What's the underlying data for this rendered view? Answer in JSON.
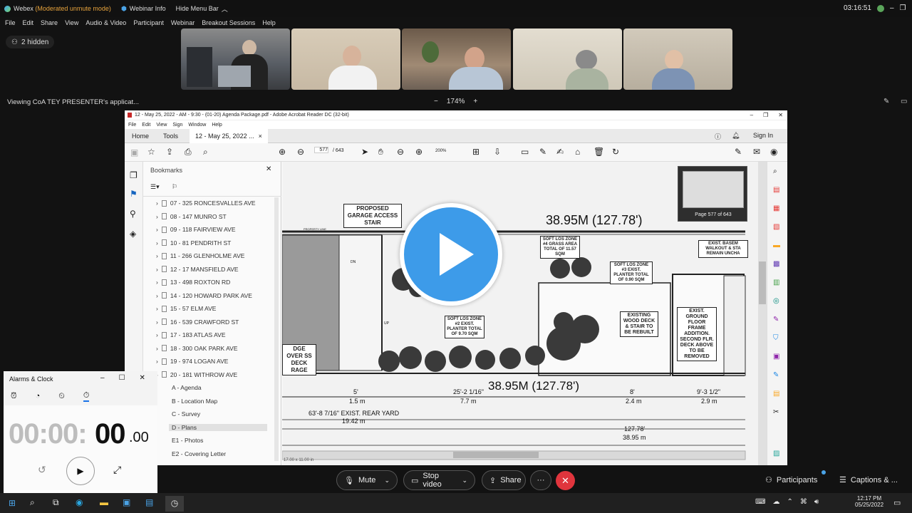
{
  "titlebar": {
    "app": "Webex",
    "mode": "(Moderated unmute mode)",
    "webinar_info": "Webinar Info",
    "hide_menu": "Hide Menu Bar",
    "clock": "03:16:51"
  },
  "menubar": [
    "File",
    "Edit",
    "Share",
    "View",
    "Audio & Video",
    "Participant",
    "Webinar",
    "Breakout Sessions",
    "Help"
  ],
  "hidden_count": "2 hidden",
  "viewing": "Viewing CoA TEY PRESENTER's applicat...",
  "zoom": {
    "minus": "−",
    "level": "174%",
    "plus": "+"
  },
  "acrobat": {
    "title": "12 - May 25, 2022 - AM - 9:30 - (01-20) Agenda Package.pdf - Adobe Acrobat Reader DC (32-bit)",
    "menu": [
      "File",
      "Edit",
      "View",
      "Sign",
      "Window",
      "Help"
    ],
    "tabs": {
      "home": "Home",
      "tools": "Tools",
      "doc": "12 - May 25, 2022 ...",
      "close": "×",
      "signin": "Sign In"
    },
    "page_current": "577",
    "page_total": "/ 643",
    "zoom": "200%",
    "bookmarks_title": "Bookmarks",
    "bookmarks": [
      "07 - 325 RONCESVALLES AVE",
      "08 - 147 MUNRO ST",
      "09 - 118 FAIRVIEW AVE",
      "10 - 81 PENDRITH ST",
      "11 - 266 GLENHOLME AVE",
      "12 - 17 MANSFIELD AVE",
      "13 - 498 ROXTON RD",
      "14 - 120 HOWARD PARK AVE",
      "15 - 57 ELM AVE",
      "16 - 539 CRAWFORD ST",
      "17 - 183 ATLAS AVE",
      "18 - 300 OAK PARK AVE",
      "19 - 974 LOGAN AVE",
      "20 - 181 WITHROW AVE"
    ],
    "sub_bookmarks": [
      "A - Agenda",
      "B - Location Map",
      "C - Survey",
      "D - Plans",
      "E1 - Photos",
      "E2 - Covering Letter"
    ],
    "page_size": "17.00 x 11.00 in",
    "thumb_label": "Page 577 of 643",
    "drawing": {
      "garage": "PROPOSED GARAGE ACCESS STAIR",
      "dim_top": "38.95M (127.78')",
      "dim_bottom": "38.95M (127.78')",
      "zone4": "SOFT LOS ZONE #4 GRASS AREA TOTAL OF 11.57 SQM",
      "zone3": "SOFT LOS ZONE #3 EXIST. PLANTER TOTAL OF 0.90 SQM",
      "zone2": "SOFT LOS ZONE #2 EXIST. PLANTER TOTAL OF 9.70 SQM",
      "wood_deck": "EXISTING WOOD DECK & STAIR TO BE REBUILT",
      "ground_floor": "EXIST. GROUND FLOOR FRAME ADDITION. SECOND FLR. DECK ABOVE TO BE REMOVED",
      "basement": "EXIST. BASEM WALKOUT & STA REMAIN UNCHA",
      "bridge": "DGE OVER SS DECK RAGE",
      "d1a": "5'",
      "d1b": "1.5 m",
      "d2a": "25'-2 1/16\"",
      "d2b": "7.7 m",
      "d3a": "8'",
      "d3b": "2.4 m",
      "d4a": "9'-3 1/2\"",
      "d4b": "2.9 m",
      "rear_yard": "63'-8 7/16\" EXIST. REAR YARD",
      "rear_m": "19.42 m",
      "total_ft": "127.78'",
      "total_m": "38.95 m",
      "property_line": "PROPERTY LINE",
      "dn": "DN",
      "up": "UP"
    }
  },
  "alarms": {
    "title": "Alarms & Clock",
    "time_main": "00:00:",
    "time_sec": "00",
    "time_frac": ".00"
  },
  "controls": {
    "mute": "Mute",
    "stop_video": "Stop video",
    "share": "Share",
    "more": "···",
    "participants": "Participants",
    "captions": "Captions & ..."
  },
  "taskbar": {
    "time": "12:17 PM",
    "date": "05/25/2022"
  },
  "colors": {
    "accent": "#4aa3e6",
    "end": "#e0353d",
    "webex_green": "#5aa55a",
    "mode_orange": "#e6a23c"
  }
}
